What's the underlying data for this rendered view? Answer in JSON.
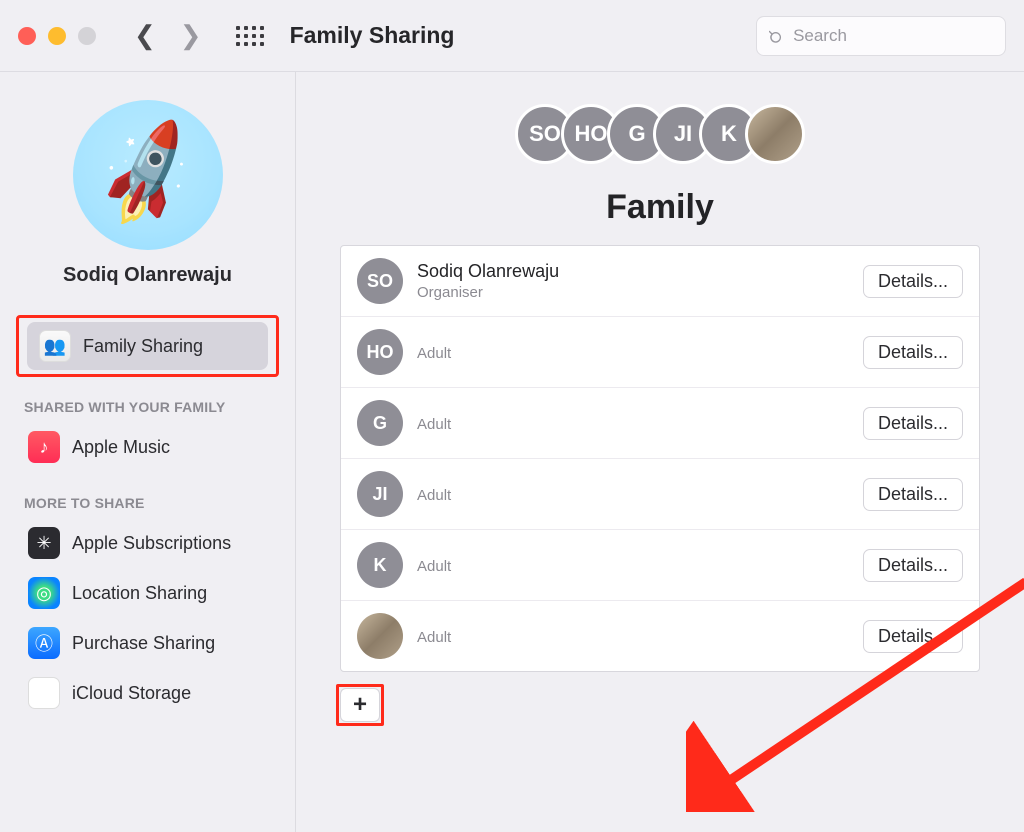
{
  "toolbar": {
    "title": "Family Sharing",
    "search_placeholder": "Search"
  },
  "sidebar": {
    "profile_name": "Sodiq Olanrewaju",
    "items": [
      {
        "label": "Family Sharing",
        "selected": true
      }
    ],
    "shared_header": "SHARED WITH YOUR FAMILY",
    "shared_items": [
      {
        "label": "Apple Music"
      }
    ],
    "more_header": "MORE TO SHARE",
    "more_items": [
      {
        "label": "Apple Subscriptions"
      },
      {
        "label": "Location Sharing"
      },
      {
        "label": "Purchase Sharing"
      },
      {
        "label": "iCloud Storage"
      }
    ]
  },
  "main": {
    "title": "Family",
    "avatars": [
      "SO",
      "HO",
      "G",
      "JI",
      "K"
    ],
    "members": [
      {
        "initials": "SO",
        "name": "Sodiq Olanrewaju",
        "role": "Organiser",
        "details": "Details..."
      },
      {
        "initials": "HO",
        "name": "",
        "role": "Adult",
        "details": "Details..."
      },
      {
        "initials": "G",
        "name": "",
        "role": "Adult",
        "details": "Details..."
      },
      {
        "initials": "JI",
        "name": "",
        "role": "Adult",
        "details": "Details..."
      },
      {
        "initials": "K",
        "name": "",
        "role": "Adult",
        "details": "Details..."
      },
      {
        "initials": "",
        "name": "",
        "role": "Adult",
        "details": "Details...",
        "photo": true
      }
    ],
    "add_label": "+"
  }
}
